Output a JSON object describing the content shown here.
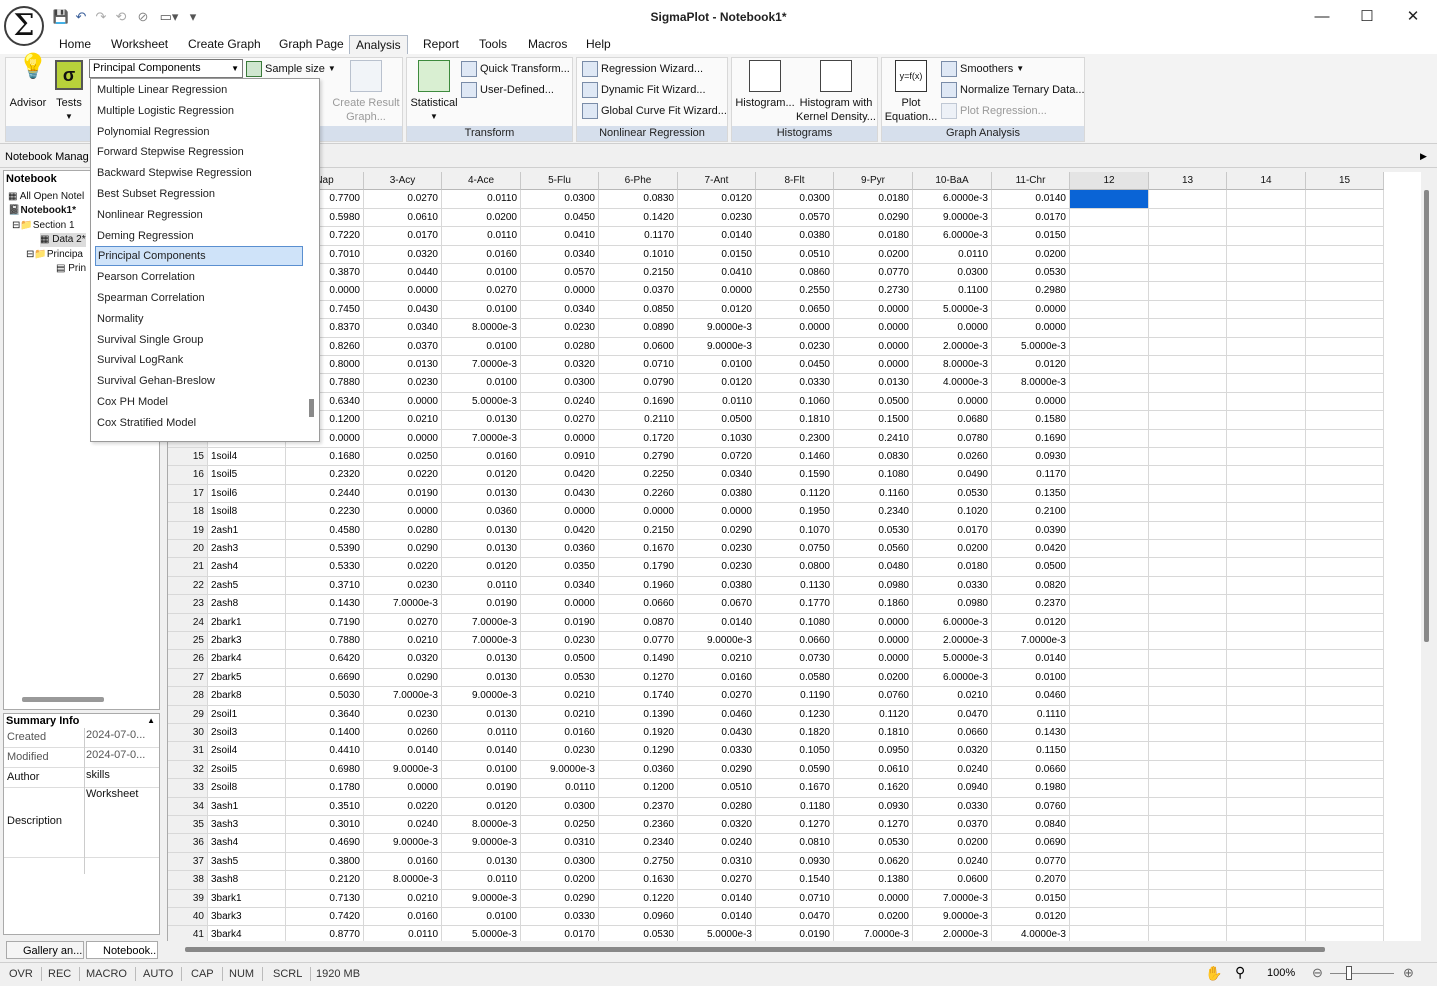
{
  "app": {
    "title": "SigmaPlot - Notebook1*"
  },
  "menus": [
    "Home",
    "Worksheet",
    "Create Graph",
    "Graph Page",
    "Analysis",
    "Report",
    "Tools",
    "Macros",
    "Help"
  ],
  "ribbon": {
    "advisor": "Advisor",
    "tests": "Tests",
    "combo_value": "Principal Components",
    "sample_size": "Sample size",
    "create_result_graph": "Create Result Graph...",
    "statistical": "Statistical",
    "quick_transform": "Quick Transform...",
    "user_defined": "User-Defined...",
    "transform_label": "Transform",
    "regression_wizard": "Regression Wizard...",
    "dynamic_fit_wizard": "Dynamic Fit Wizard...",
    "global_curve_fit_wizard": "Global Curve Fit Wizard...",
    "nonlinear_regression_label": "Nonlinear Regression",
    "histogram": "Histogram...",
    "histogram_kernel": "Histogram with Kernel Density...",
    "histograms_label": "Histograms",
    "plot_equation": "Plot Equation...",
    "smoothers": "Smoothers",
    "normalize_ternary": "Normalize Ternary Data...",
    "plot_regression": "Plot Regression...",
    "graph_analysis_label": "Graph Analysis"
  },
  "dropdown": {
    "items": [
      "Multiple Linear Regression",
      "Multiple Logistic Regression",
      "Polynomial Regression",
      "Forward Stepwise Regression",
      "Backward Stepwise Regression",
      "Best Subset Regression",
      "Nonlinear Regression",
      "Deming Regression",
      "Principal Components",
      "Pearson Correlation",
      "Spearman Correlation",
      "Normality",
      "Survival Single Group",
      "Survival LogRank",
      "Survival Gehan-Breslow",
      "Cox PH Model",
      "Cox Stratified Model"
    ],
    "selected": "Principal Components"
  },
  "notebook_manager": {
    "header": "Notebook Manag",
    "tab_notebook": "Notebook",
    "tree": [
      "All Open Notel",
      "Notebook1*",
      "Section 1",
      "Data 2*",
      "Principa",
      "Prin"
    ]
  },
  "summary": {
    "title": "Summary Info",
    "rows": [
      {
        "k": "Created",
        "v": "2024-07-0..."
      },
      {
        "k": "Modified",
        "v": "2024-07-0..."
      },
      {
        "k": "Author",
        "v": "skills"
      },
      {
        "k": "Description",
        "v": "Worksheet"
      }
    ]
  },
  "bottom_tabs": [
    "Gallery an...",
    "Notebook..."
  ],
  "grid": {
    "headers": [
      "Nap",
      "3-Acy",
      "4-Ace",
      "5-Flu",
      "6-Phe",
      "7-Ant",
      "8-Flt",
      "9-Pyr",
      "10-BaA",
      "11-Chr",
      "12",
      "13",
      "14",
      "15"
    ],
    "rows": [
      [
        "",
        "",
        "0.7700",
        "0.0270",
        "0.0110",
        "0.0300",
        "0.0830",
        "0.0120",
        "0.0300",
        "0.0180",
        "6.0000e-3",
        "0.0140"
      ],
      [
        "",
        "",
        "0.5980",
        "0.0610",
        "0.0200",
        "0.0450",
        "0.1420",
        "0.0230",
        "0.0570",
        "0.0290",
        "9.0000e-3",
        "0.0170"
      ],
      [
        "",
        "",
        "0.7220",
        "0.0170",
        "0.0110",
        "0.0410",
        "0.1170",
        "0.0140",
        "0.0380",
        "0.0180",
        "6.0000e-3",
        "0.0150"
      ],
      [
        "",
        "",
        "0.7010",
        "0.0320",
        "0.0160",
        "0.0340",
        "0.1010",
        "0.0150",
        "0.0510",
        "0.0200",
        "0.0110",
        "0.0200"
      ],
      [
        "",
        "",
        "0.3870",
        "0.0440",
        "0.0100",
        "0.0570",
        "0.2150",
        "0.0410",
        "0.0860",
        "0.0770",
        "0.0300",
        "0.0530"
      ],
      [
        "",
        "",
        "0.0000",
        "0.0000",
        "0.0270",
        "0.0000",
        "0.0370",
        "0.0000",
        "0.2550",
        "0.2730",
        "0.1100",
        "0.2980"
      ],
      [
        "",
        "",
        "0.7450",
        "0.0430",
        "0.0100",
        "0.0340",
        "0.0850",
        "0.0120",
        "0.0650",
        "0.0000",
        "5.0000e-3",
        "0.0000"
      ],
      [
        "",
        "",
        "0.8370",
        "0.0340",
        "8.0000e-3",
        "0.0230",
        "0.0890",
        "9.0000e-3",
        "0.0000",
        "0.0000",
        "0.0000",
        "0.0000"
      ],
      [
        "",
        "",
        "0.8260",
        "0.0370",
        "0.0100",
        "0.0280",
        "0.0600",
        "9.0000e-3",
        "0.0230",
        "0.0000",
        "2.0000e-3",
        "5.0000e-3"
      ],
      [
        "",
        "",
        "0.8000",
        "0.0130",
        "7.0000e-3",
        "0.0320",
        "0.0710",
        "0.0100",
        "0.0450",
        "0.0000",
        "8.0000e-3",
        "0.0120"
      ],
      [
        "",
        "",
        "0.7880",
        "0.0230",
        "0.0100",
        "0.0300",
        "0.0790",
        "0.0120",
        "0.0330",
        "0.0130",
        "4.0000e-3",
        "8.0000e-3"
      ],
      [
        "",
        "",
        "0.6340",
        "0.0000",
        "5.0000e-3",
        "0.0240",
        "0.1690",
        "0.0110",
        "0.1060",
        "0.0500",
        "0.0000",
        "0.0000"
      ],
      [
        "",
        "",
        "0.1200",
        "0.0210",
        "0.0130",
        "0.0270",
        "0.2110",
        "0.0500",
        "0.1810",
        "0.1500",
        "0.0680",
        "0.1580"
      ],
      [
        "",
        "",
        "0.0000",
        "0.0000",
        "7.0000e-3",
        "0.0000",
        "0.1720",
        "0.1030",
        "0.2300",
        "0.2410",
        "0.0780",
        "0.1690"
      ],
      [
        "15",
        "1soil4",
        "0.1680",
        "0.0250",
        "0.0160",
        "0.0910",
        "0.2790",
        "0.0720",
        "0.1460",
        "0.0830",
        "0.0260",
        "0.0930"
      ],
      [
        "16",
        "1soil5",
        "0.2320",
        "0.0220",
        "0.0120",
        "0.0420",
        "0.2250",
        "0.0340",
        "0.1590",
        "0.1080",
        "0.0490",
        "0.1170"
      ],
      [
        "17",
        "1soil6",
        "0.2440",
        "0.0190",
        "0.0130",
        "0.0430",
        "0.2260",
        "0.0380",
        "0.1120",
        "0.1160",
        "0.0530",
        "0.1350"
      ],
      [
        "18",
        "1soil8",
        "0.2230",
        "0.0000",
        "0.0360",
        "0.0000",
        "0.0000",
        "0.0000",
        "0.1950",
        "0.2340",
        "0.1020",
        "0.2100"
      ],
      [
        "19",
        "2ash1",
        "0.4580",
        "0.0280",
        "0.0130",
        "0.0420",
        "0.2150",
        "0.0290",
        "0.1070",
        "0.0530",
        "0.0170",
        "0.0390"
      ],
      [
        "20",
        "2ash3",
        "0.5390",
        "0.0290",
        "0.0130",
        "0.0360",
        "0.1670",
        "0.0230",
        "0.0750",
        "0.0560",
        "0.0200",
        "0.0420"
      ],
      [
        "21",
        "2ash4",
        "0.5330",
        "0.0220",
        "0.0120",
        "0.0350",
        "0.1790",
        "0.0230",
        "0.0800",
        "0.0480",
        "0.0180",
        "0.0500"
      ],
      [
        "22",
        "2ash5",
        "0.3710",
        "0.0230",
        "0.0110",
        "0.0340",
        "0.1960",
        "0.0380",
        "0.1130",
        "0.0980",
        "0.0330",
        "0.0820"
      ],
      [
        "23",
        "2ash8",
        "0.1430",
        "7.0000e-3",
        "0.0190",
        "0.0000",
        "0.0660",
        "0.0670",
        "0.1770",
        "0.1860",
        "0.0980",
        "0.2370"
      ],
      [
        "24",
        "2bark1",
        "0.7190",
        "0.0270",
        "7.0000e-3",
        "0.0190",
        "0.0870",
        "0.0140",
        "0.1080",
        "0.0000",
        "6.0000e-3",
        "0.0120"
      ],
      [
        "25",
        "2bark3",
        "0.7880",
        "0.0210",
        "7.0000e-3",
        "0.0230",
        "0.0770",
        "9.0000e-3",
        "0.0660",
        "0.0000",
        "2.0000e-3",
        "7.0000e-3"
      ],
      [
        "26",
        "2bark4",
        "0.6420",
        "0.0320",
        "0.0130",
        "0.0500",
        "0.1490",
        "0.0210",
        "0.0730",
        "0.0000",
        "5.0000e-3",
        "0.0140"
      ],
      [
        "27",
        "2bark5",
        "0.6690",
        "0.0290",
        "0.0130",
        "0.0530",
        "0.1270",
        "0.0160",
        "0.0580",
        "0.0200",
        "6.0000e-3",
        "0.0100"
      ],
      [
        "28",
        "2bark8",
        "0.5030",
        "7.0000e-3",
        "9.0000e-3",
        "0.0210",
        "0.1740",
        "0.0270",
        "0.1190",
        "0.0760",
        "0.0210",
        "0.0460"
      ],
      [
        "29",
        "2soil1",
        "0.3640",
        "0.0230",
        "0.0130",
        "0.0210",
        "0.1390",
        "0.0460",
        "0.1230",
        "0.1120",
        "0.0470",
        "0.1110"
      ],
      [
        "30",
        "2soil3",
        "0.1400",
        "0.0260",
        "0.0110",
        "0.0160",
        "0.1920",
        "0.0430",
        "0.1820",
        "0.1810",
        "0.0660",
        "0.1430"
      ],
      [
        "31",
        "2soil4",
        "0.4410",
        "0.0140",
        "0.0140",
        "0.0230",
        "0.1290",
        "0.0330",
        "0.1050",
        "0.0950",
        "0.0320",
        "0.1150"
      ],
      [
        "32",
        "2soil5",
        "0.6980",
        "9.0000e-3",
        "0.0100",
        "9.0000e-3",
        "0.0360",
        "0.0290",
        "0.0590",
        "0.0610",
        "0.0240",
        "0.0660"
      ],
      [
        "33",
        "2soil8",
        "0.1780",
        "0.0000",
        "0.0190",
        "0.0110",
        "0.1200",
        "0.0510",
        "0.1670",
        "0.1620",
        "0.0940",
        "0.1980"
      ],
      [
        "34",
        "3ash1",
        "0.3510",
        "0.0220",
        "0.0120",
        "0.0300",
        "0.2370",
        "0.0280",
        "0.1180",
        "0.0930",
        "0.0330",
        "0.0760"
      ],
      [
        "35",
        "3ash3",
        "0.3010",
        "0.0240",
        "8.0000e-3",
        "0.0250",
        "0.2360",
        "0.0320",
        "0.1270",
        "0.1270",
        "0.0370",
        "0.0840"
      ],
      [
        "36",
        "3ash4",
        "0.4690",
        "9.0000e-3",
        "9.0000e-3",
        "0.0310",
        "0.2340",
        "0.0240",
        "0.0810",
        "0.0530",
        "0.0200",
        "0.0690"
      ],
      [
        "37",
        "3ash5",
        "0.3800",
        "0.0160",
        "0.0130",
        "0.0300",
        "0.2750",
        "0.0310",
        "0.0930",
        "0.0620",
        "0.0240",
        "0.0770"
      ],
      [
        "38",
        "3ash8",
        "0.2120",
        "8.0000e-3",
        "0.0110",
        "0.0200",
        "0.1630",
        "0.0270",
        "0.1540",
        "0.1380",
        "0.0600",
        "0.2070"
      ],
      [
        "39",
        "3bark1",
        "0.7130",
        "0.0210",
        "9.0000e-3",
        "0.0290",
        "0.1220",
        "0.0140",
        "0.0710",
        "0.0000",
        "7.0000e-3",
        "0.0150"
      ],
      [
        "40",
        "3bark3",
        "0.7420",
        "0.0160",
        "0.0100",
        "0.0330",
        "0.0960",
        "0.0140",
        "0.0470",
        "0.0200",
        "9.0000e-3",
        "0.0120"
      ],
      [
        "41",
        "3bark4",
        "0.8770",
        "0.0110",
        "5.0000e-3",
        "0.0170",
        "0.0530",
        "5.0000e-3",
        "0.0190",
        "7.0000e-3",
        "2.0000e-3",
        "4.0000e-3"
      ]
    ]
  },
  "status": [
    "OVR",
    "REC",
    "MACRO",
    "AUTO",
    "CAP",
    "NUM",
    "SCRL",
    "1920 MB"
  ],
  "zoom": "100%"
}
